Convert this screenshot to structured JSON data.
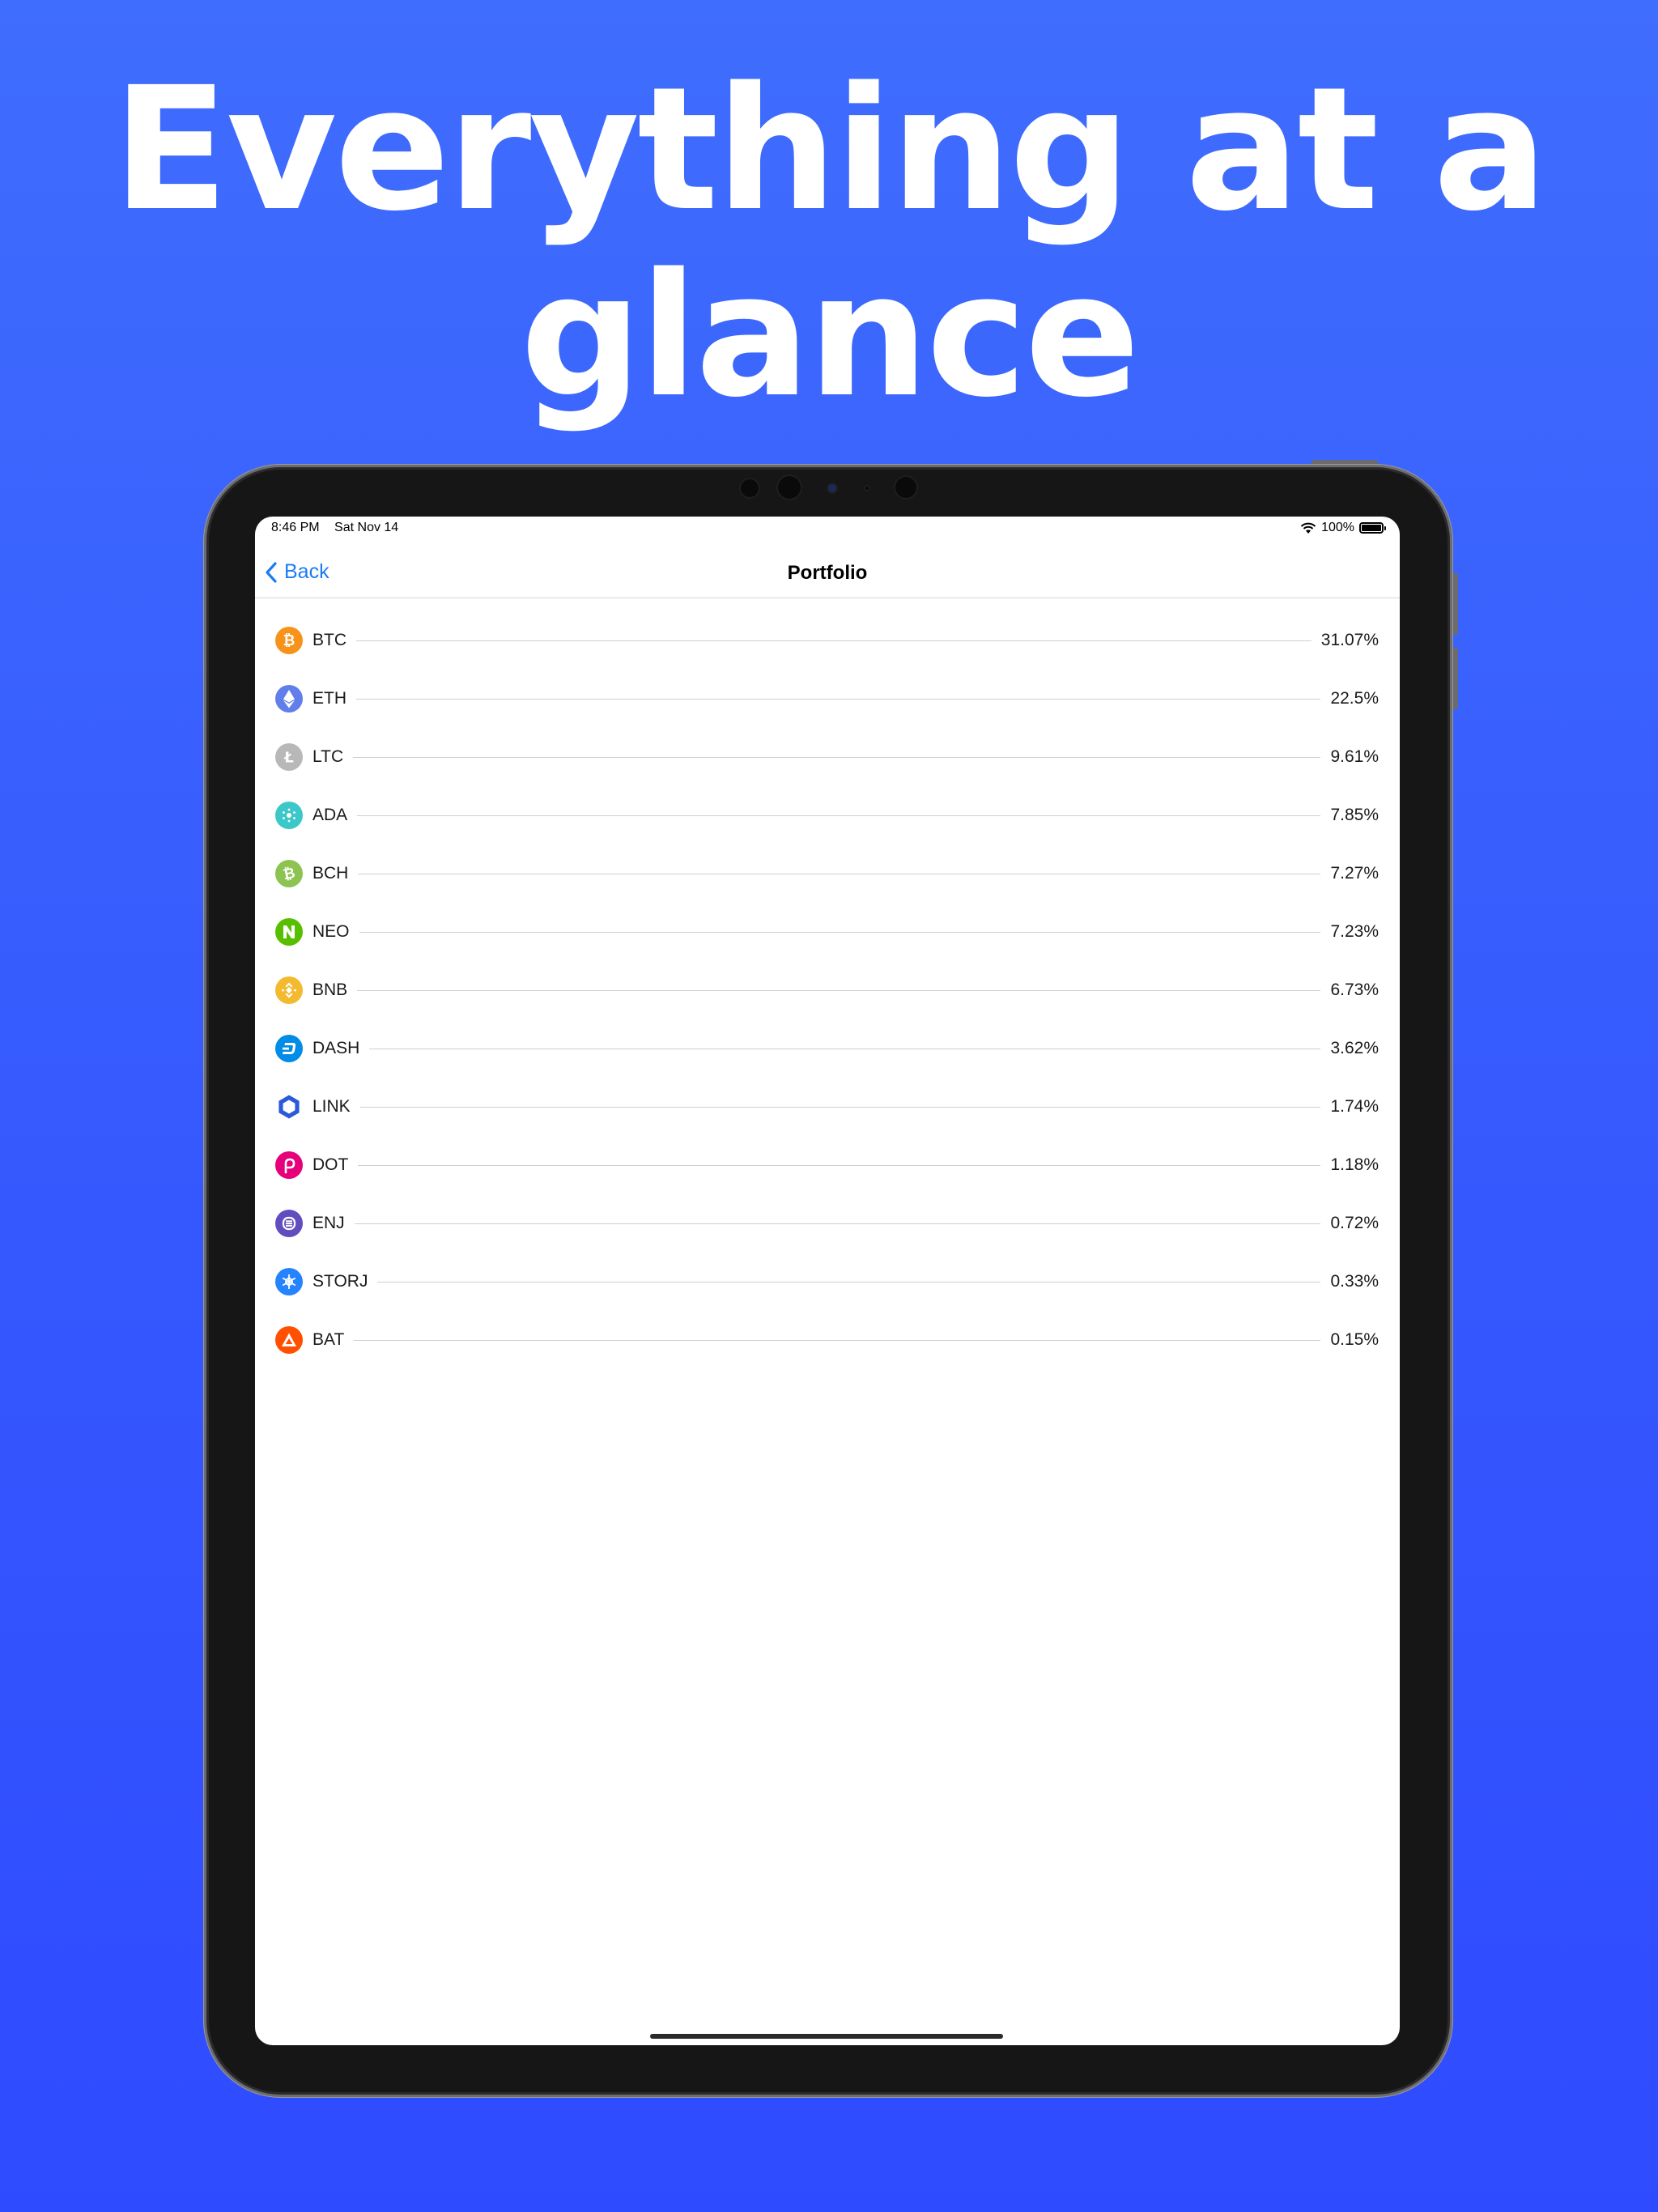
{
  "headline": {
    "line1": "Everything at a",
    "line2": "glance"
  },
  "status_bar": {
    "time": "8:46 PM",
    "date": "Sat Nov 14",
    "battery": "100%"
  },
  "nav": {
    "back_label": "Back",
    "title": "Portfolio"
  },
  "colors": {
    "background": "#3558fe",
    "accent": "#1a7cf5"
  },
  "portfolio": [
    {
      "symbol": "BTC",
      "percent": "31.07%",
      "icon": "bitcoin-icon",
      "color": "#f7931a"
    },
    {
      "symbol": "ETH",
      "percent": "22.5%",
      "icon": "ethereum-icon",
      "color": "#627eea"
    },
    {
      "symbol": "LTC",
      "percent": "9.61%",
      "icon": "litecoin-icon",
      "color": "#b8b8b8"
    },
    {
      "symbol": "ADA",
      "percent": "7.85%",
      "icon": "cardano-icon",
      "color": "#3cc8c8"
    },
    {
      "symbol": "BCH",
      "percent": "7.27%",
      "icon": "bitcoin-cash-icon",
      "color": "#8dc351"
    },
    {
      "symbol": "NEO",
      "percent": "7.23%",
      "icon": "neo-icon",
      "color": "#58bf00"
    },
    {
      "symbol": "BNB",
      "percent": "6.73%",
      "icon": "binance-icon",
      "color": "#f3ba2f"
    },
    {
      "symbol": "DASH",
      "percent": "3.62%",
      "icon": "dash-icon",
      "color": "#008ce7"
    },
    {
      "symbol": "LINK",
      "percent": "1.74%",
      "icon": "chainlink-icon",
      "color": "#2a5ada"
    },
    {
      "symbol": "DOT",
      "percent": "1.18%",
      "icon": "polkadot-icon",
      "color": "#e6007a"
    },
    {
      "symbol": "ENJ",
      "percent": "0.72%",
      "icon": "enjin-icon",
      "color": "#624dbf"
    },
    {
      "symbol": "STORJ",
      "percent": "0.33%",
      "icon": "storj-icon",
      "color": "#2683ff"
    },
    {
      "symbol": "BAT",
      "percent": "0.15%",
      "icon": "bat-icon",
      "color": "#ff5000"
    }
  ]
}
